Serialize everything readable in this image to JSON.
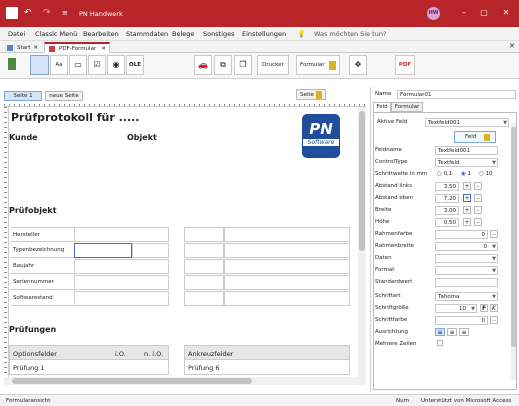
{
  "app": {
    "title": "PN Handwerk",
    "user_initials": "HW",
    "search_placeholder": "Was möchten Sie tun?"
  },
  "menu": [
    "Datei",
    "Classic Menü",
    "Bearbeiten",
    "Stammdaten",
    "Belege",
    "Sonstiges",
    "Einstellungen"
  ],
  "tabs": {
    "start": "Start",
    "pdf": "PDF-Formular"
  },
  "ribbon": {
    "aa": "Aa",
    "ole": "OLE",
    "print": "Drucker",
    "form": "Formular",
    "pdf": "PDF"
  },
  "page_tabs": {
    "page1": "Seite 1",
    "new_page": "neue Seite",
    "page_btn": "Seite"
  },
  "canvas": {
    "title": "Prüfprotokoll für .....",
    "customer": "Kunde",
    "object": "Objekt",
    "inspection_object": "Prüfobjekt",
    "fields": [
      "Hersteller",
      "Typenbezeichnung",
      "Baujahr",
      "Seriennummer",
      "Softwarestand"
    ],
    "tests": "Prüfungen",
    "tests_header": [
      "Optionsfelder",
      "i.O.",
      "n. i.O."
    ],
    "tests_row": "Prüfung 1",
    "checkbox_header": "Ankreuzfelder",
    "checkbox_row": "Prüfung 6",
    "logo_line1": "PN",
    "logo_line2": "Software"
  },
  "props": {
    "name_label": "Name",
    "name_value": "Formular01",
    "tab_field": "Feld",
    "tab_form": "Formular",
    "active_field_label": "Aktive Feld",
    "active_field_value": "Textfeld001",
    "field_btn": "Feld",
    "fieldname_label": "Feldname",
    "fieldname_value": "Textfeld001",
    "controltype_label": "ControlType",
    "controltype_value": "Textfeld",
    "step_label": "Schrittweite in mm",
    "step_options": [
      "0,1",
      "1",
      "10"
    ],
    "step_selected": "1",
    "left_label": "Abstand links",
    "left_value": "3,50",
    "top_label": "Abstand oben",
    "top_value": "7,20",
    "width_label": "Breite",
    "width_value": "3,00",
    "height_label": "Höhe",
    "height_value": "0,50",
    "border_color_label": "Rahmenfarbe",
    "border_color_value": "0",
    "border_width_label": "Rahmenbreite",
    "border_width_value": "0",
    "data_label": "Daten",
    "format_label": "Format",
    "default_label": "Standardwert",
    "font_label": "Schriftart",
    "font_value": "Tahoma",
    "font_size_label": "Schriftgröße",
    "font_size_value": "10",
    "bold": "F",
    "italic": "K",
    "font_color_label": "Schriftfarbe",
    "font_color_value": "0",
    "align_label": "Ausrichtung",
    "multiline_label": "Mehrere Zeilen"
  },
  "status": {
    "left": "Formularansicht",
    "num": "Num",
    "right": "Unterstützt von Microsoft Access"
  },
  "colors": {
    "accent": "#b7252a",
    "selection": "#3b6fd1"
  }
}
